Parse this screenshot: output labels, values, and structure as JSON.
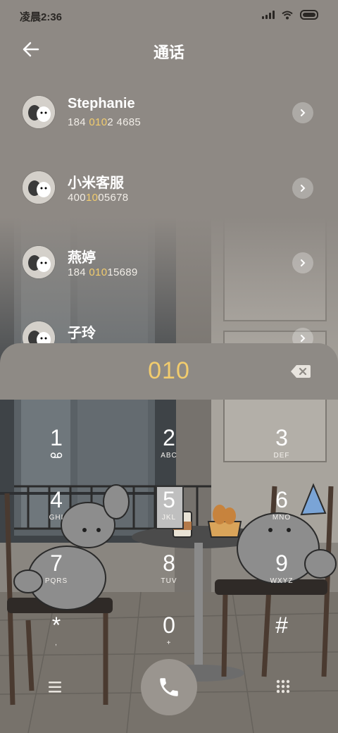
{
  "status_bar": {
    "time": "凌晨2:36"
  },
  "header": {
    "title": "通话"
  },
  "contacts": [
    {
      "name": "Stephanie",
      "number_pre": "184 ",
      "number_match": "010",
      "number_post": "2 4685"
    },
    {
      "name": "小米客服",
      "number_pre": "400",
      "number_match": "10",
      "number_post": "05678"
    },
    {
      "name": "燕婷",
      "number_pre": "184 ",
      "number_match": "010",
      "number_post": "15689"
    },
    {
      "name": "子玲",
      "number_pre": "",
      "number_match": "",
      "number_post": ""
    }
  ],
  "dialer": {
    "input": "010",
    "keys": [
      {
        "digit": "1",
        "letters": ""
      },
      {
        "digit": "2",
        "letters": "ABC"
      },
      {
        "digit": "3",
        "letters": "DEF"
      },
      {
        "digit": "4",
        "letters": "GHI"
      },
      {
        "digit": "5",
        "letters": "JKL"
      },
      {
        "digit": "6",
        "letters": "MNO"
      },
      {
        "digit": "7",
        "letters": "PQRS"
      },
      {
        "digit": "8",
        "letters": "TUV"
      },
      {
        "digit": "9",
        "letters": "WXYZ"
      },
      {
        "digit": "*",
        "letters": ","
      },
      {
        "digit": "0",
        "letters": "+"
      },
      {
        "digit": "#",
        "letters": ""
      }
    ]
  },
  "colors": {
    "match_highlight": "#f2cc6d",
    "panel": "#8e8a85",
    "text": "#ffffff"
  },
  "icons": {
    "back": "back-arrow-icon",
    "backspace": "backspace-icon",
    "menu": "menu-icon",
    "call": "phone-icon",
    "keypad": "keypad-icon",
    "voicemail": "voicemail-icon"
  }
}
